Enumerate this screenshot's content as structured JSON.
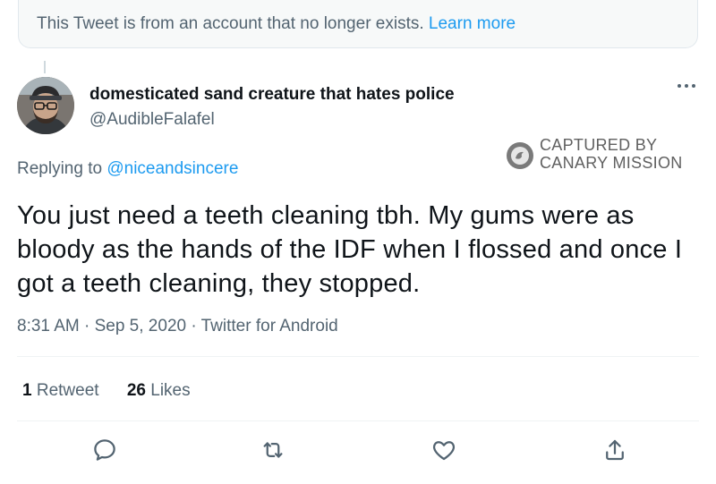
{
  "notice": {
    "text": "This Tweet is from an account that no longer exists.",
    "link": "Learn more"
  },
  "tweet": {
    "display_name": "domesticated sand creature that hates police",
    "handle": "@AudibleFalafel",
    "reply_prefix": "Replying to",
    "reply_to": "@niceandsincere",
    "text": "You just need a teeth cleaning tbh. My gums were as bloody as the hands of the IDF when I flossed and once I got a teeth cleaning, they stopped.",
    "timestamp": "8:31 AM · Sep 5, 2020 · Twitter for Android"
  },
  "watermark": {
    "line1": "CAPTURED BY",
    "line2": "CANARY MISSION"
  },
  "stats": {
    "retweets_count": "1",
    "retweets_label": "Retweet",
    "likes_count": "26",
    "likes_label": "Likes"
  },
  "actions": [
    "reply-icon",
    "retweet-icon",
    "like-icon",
    "share-icon"
  ],
  "colors": {
    "link": "#1d9bf0",
    "secondary_text": "#536471",
    "primary_text": "#0f1419"
  }
}
